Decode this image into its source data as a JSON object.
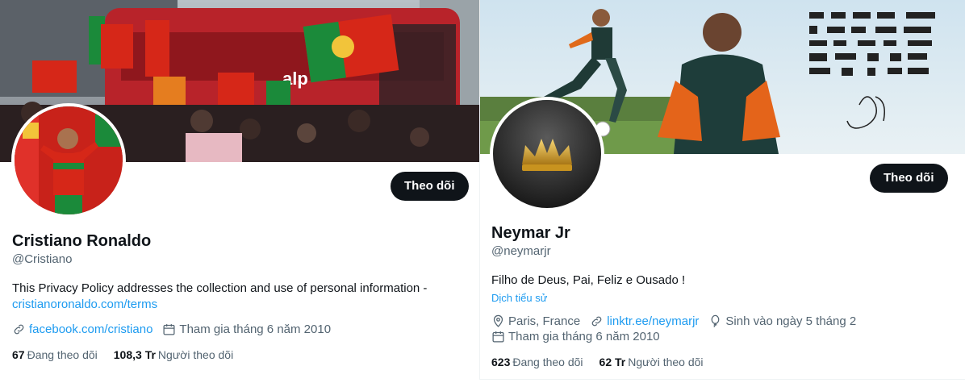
{
  "profiles": [
    {
      "name": "Cristiano Ronaldo",
      "handle": "@Cristiano",
      "follow_label": "Theo dõi",
      "bio_text": "This Privacy Policy addresses the collection and use of personal information -",
      "bio_link": "cristianoronaldo.com/terms",
      "website": "facebook.com/cristiano",
      "joined": "Tham gia tháng 6 năm 2010",
      "following_count": "67",
      "following_label": "Đang theo dõi",
      "followers_count": "108,3 Tr",
      "followers_label": "Người theo dõi"
    },
    {
      "name": "Neymar Jr",
      "handle": "@neymarjr",
      "follow_label": "Theo dõi",
      "bio_text": "Filho de Deus, Pai, Feliz e Ousado !",
      "translate_label": "Dịch tiểu sử",
      "location": "Paris, France",
      "website": "linktr.ee/neymarjr",
      "birthday": "Sinh vào ngày 5 tháng 2",
      "joined": "Tham gia tháng 6 năm 2010",
      "following_count": "623",
      "following_label": "Đang theo dõi",
      "followers_count": "62 Tr",
      "followers_label": "Người theo dõi"
    }
  ],
  "colors": {
    "accent": "#1d9bf0",
    "button_bg": "#0f1419",
    "text_secondary": "#536471"
  },
  "icons": [
    "link-icon",
    "calendar-icon",
    "location-icon",
    "balloon-icon",
    "crown-icon"
  ]
}
